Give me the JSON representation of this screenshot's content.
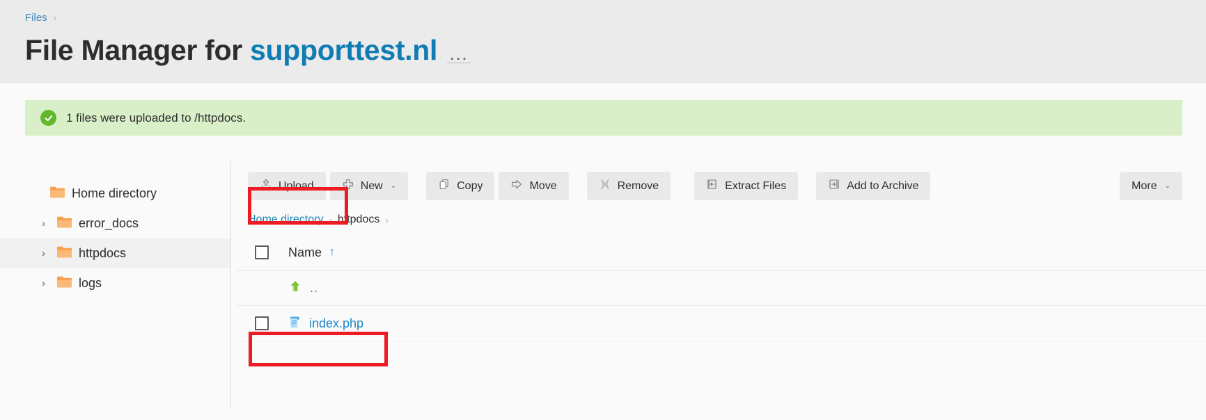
{
  "header": {
    "breadcrumb": {
      "items": [
        "Files"
      ],
      "separator": "›"
    },
    "title_prefix": "File Manager for",
    "title_domain": "supporttest.nl",
    "ellipsis": "…"
  },
  "alert": {
    "icon": "check-circle-icon",
    "message": "1 files were uploaded to /httpdocs.",
    "background": "#d9efc8",
    "icon_color": "#62b82b"
  },
  "sidebar": {
    "items": [
      {
        "label": "Home directory",
        "caret": "",
        "selected": false,
        "level": 0
      },
      {
        "label": "error_docs",
        "caret": "›",
        "selected": false,
        "level": 1
      },
      {
        "label": "httpdocs",
        "caret": "›",
        "selected": true,
        "level": 1
      },
      {
        "label": "logs",
        "caret": "›",
        "selected": false,
        "level": 1
      }
    ],
    "folder_color": "#f7a14e"
  },
  "toolbar": {
    "buttons": [
      {
        "label": "Upload",
        "icon": "upload-icon",
        "caret": ""
      },
      {
        "label": "New",
        "icon": "plus-icon",
        "caret": "⌄"
      },
      {
        "label": "Copy",
        "icon": "copy-icon",
        "caret": ""
      },
      {
        "label": "Move",
        "icon": "move-arrow-icon",
        "caret": ""
      },
      {
        "label": "Remove",
        "icon": "remove-x-icon",
        "caret": ""
      },
      {
        "label": "Extract Files",
        "icon": "extract-icon",
        "caret": ""
      },
      {
        "label": "Add to Archive",
        "icon": "archive-icon",
        "caret": ""
      },
      {
        "label": "More",
        "icon": "",
        "caret": "⌄"
      }
    ]
  },
  "path_breadcrumb": {
    "items": [
      {
        "label": "Home directory",
        "link": true
      },
      {
        "label": "httpdocs",
        "link": false
      }
    ],
    "separator": "›",
    "trailing_separator": "›"
  },
  "file_table": {
    "columns": [
      {
        "label": "Name",
        "sort": "↑"
      }
    ],
    "select_all_checked": false,
    "rows": [
      {
        "name": "..",
        "icon": "up-directory-icon",
        "has_checkbox": false,
        "checked": false,
        "highlighted": false
      },
      {
        "name": "index.php",
        "icon": "php-file-icon",
        "has_checkbox": true,
        "checked": false,
        "highlighted": true
      }
    ]
  },
  "annotations": {
    "accent": "#ed1c24",
    "boxes": [
      {
        "target": "upload-button"
      },
      {
        "target": "index-php-row"
      }
    ]
  }
}
